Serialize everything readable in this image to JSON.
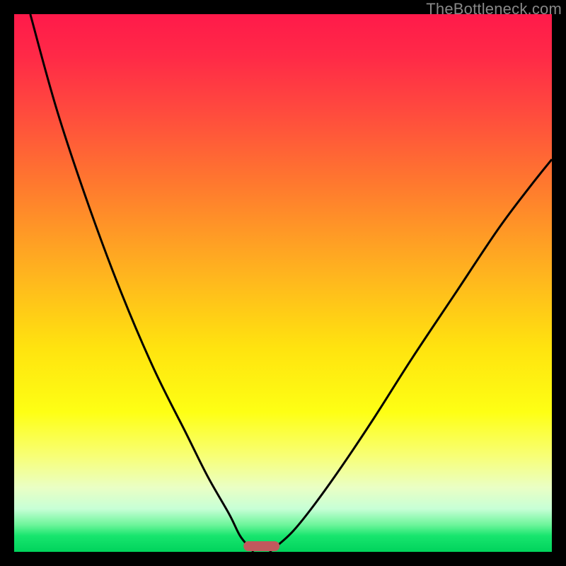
{
  "watermark": "TheBottleneck.com",
  "colors": {
    "frame_bg": "#000000",
    "curve": "#000000",
    "marker_fill": "#c1595d"
  },
  "chart_data": {
    "type": "line",
    "title": "",
    "xlabel": "",
    "ylabel": "",
    "xlim": [
      0,
      100
    ],
    "ylim": [
      0,
      100
    ],
    "grid": false,
    "legend": false,
    "annotations": [],
    "series": [
      {
        "name": "left-branch",
        "x": [
          3,
          8,
          14,
          20,
          26,
          32,
          36,
          40,
          42,
          43.8,
          44.5
        ],
        "y": [
          100,
          82,
          64,
          48,
          34,
          22,
          14,
          7,
          3,
          0.8,
          0
        ]
      },
      {
        "name": "right-branch",
        "x": [
          47.5,
          49,
          52,
          56,
          61,
          67,
          74,
          82,
          90,
          96,
          100
        ],
        "y": [
          0,
          1.2,
          4,
          9,
          16,
          25,
          36,
          48,
          60,
          68,
          73
        ]
      }
    ],
    "marker": {
      "x_center": 46,
      "width_frac": 0.068,
      "y": 0
    }
  }
}
